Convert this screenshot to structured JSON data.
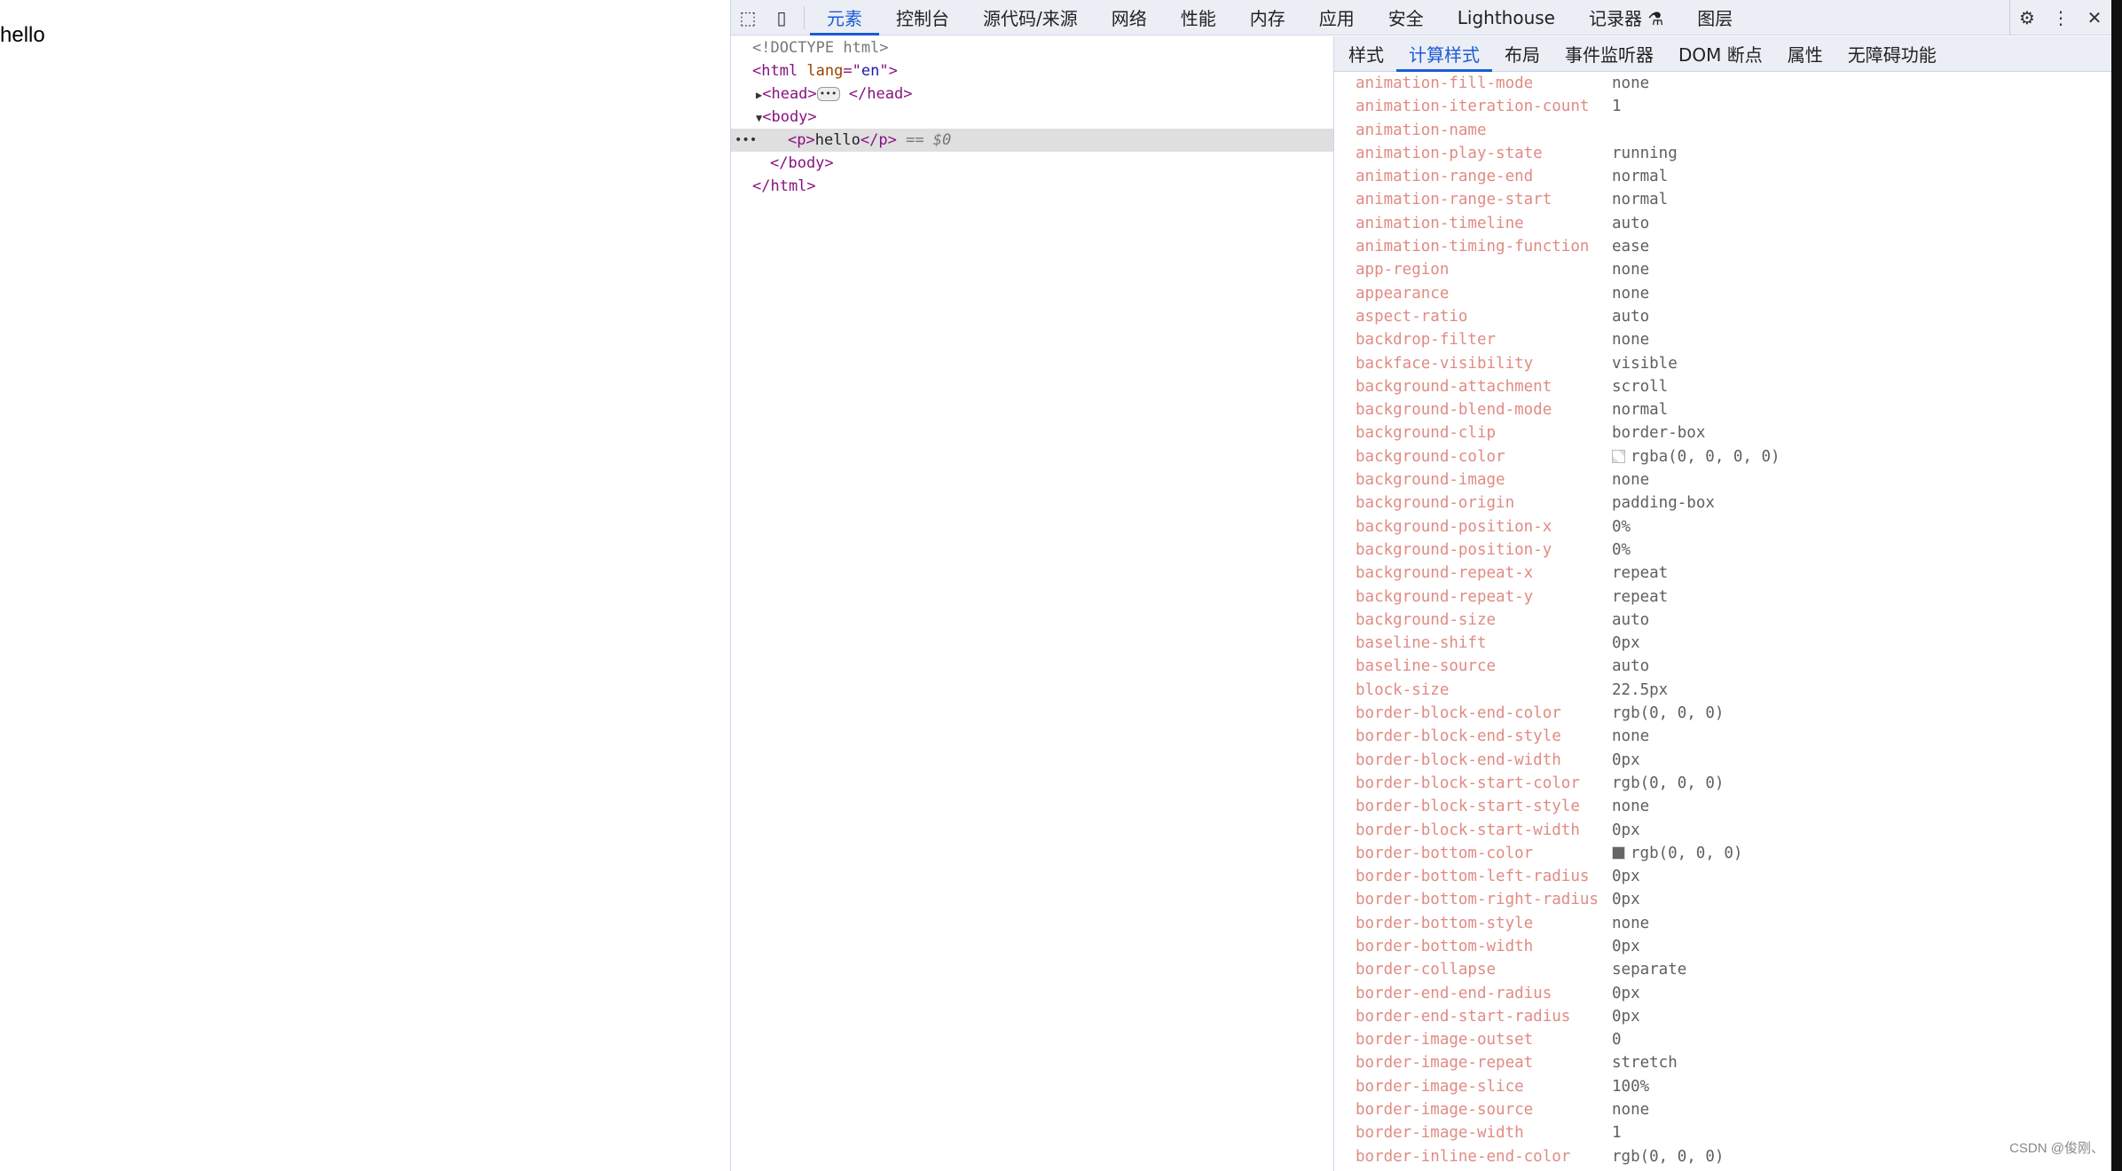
{
  "page": {
    "text": "hello"
  },
  "toolbar": {
    "tabs": [
      "元素",
      "控制台",
      "源代码/来源",
      "网络",
      "性能",
      "内存",
      "应用",
      "安全",
      "Lighthouse",
      "记录器 ⚗",
      "图层"
    ],
    "active_tab": "元素"
  },
  "dom": {
    "doctype": "<!DOCTYPE html>",
    "html_open": "<html",
    "lang_attr": " lang",
    "lang_eq": "=\"",
    "lang_val": "en",
    "lang_close": "\">",
    "head_open": "<head>",
    "head_close": "</head>",
    "body_open": "<body>",
    "p_open": "<p>",
    "p_text": "hello",
    "p_close": "</p>",
    "selected_marker": " == $0",
    "body_close": "</body>",
    "html_close": "</html>"
  },
  "sidebar": {
    "tabs": [
      "样式",
      "计算样式",
      "布局",
      "事件监听器",
      "DOM 断点",
      "属性",
      "无障碍功能"
    ],
    "active_tab": "计算样式",
    "properties": [
      {
        "name": "animation-fill-mode",
        "value": "none"
      },
      {
        "name": "animation-iteration-count",
        "value": "1"
      },
      {
        "name": "animation-name",
        "value": ""
      },
      {
        "name": "animation-play-state",
        "value": "running"
      },
      {
        "name": "animation-range-end",
        "value": "normal"
      },
      {
        "name": "animation-range-start",
        "value": "normal"
      },
      {
        "name": "animation-timeline",
        "value": "auto"
      },
      {
        "name": "animation-timing-function",
        "value": "ease"
      },
      {
        "name": "app-region",
        "value": "none"
      },
      {
        "name": "appearance",
        "value": "none"
      },
      {
        "name": "aspect-ratio",
        "value": "auto"
      },
      {
        "name": "backdrop-filter",
        "value": "none"
      },
      {
        "name": "backface-visibility",
        "value": "visible"
      },
      {
        "name": "background-attachment",
        "value": "scroll"
      },
      {
        "name": "background-blend-mode",
        "value": "normal"
      },
      {
        "name": "background-clip",
        "value": "border-box"
      },
      {
        "name": "background-color",
        "value": "rgba(0, 0, 0, 0)",
        "swatch": "transparent"
      },
      {
        "name": "background-image",
        "value": "none"
      },
      {
        "name": "background-origin",
        "value": "padding-box"
      },
      {
        "name": "background-position-x",
        "value": "0%"
      },
      {
        "name": "background-position-y",
        "value": "0%"
      },
      {
        "name": "background-repeat-x",
        "value": "repeat"
      },
      {
        "name": "background-repeat-y",
        "value": "repeat"
      },
      {
        "name": "background-size",
        "value": "auto"
      },
      {
        "name": "baseline-shift",
        "value": "0px"
      },
      {
        "name": "baseline-source",
        "value": "auto"
      },
      {
        "name": "block-size",
        "value": "22.5px"
      },
      {
        "name": "border-block-end-color",
        "value": "rgb(0, 0, 0)"
      },
      {
        "name": "border-block-end-style",
        "value": "none"
      },
      {
        "name": "border-block-end-width",
        "value": "0px"
      },
      {
        "name": "border-block-start-color",
        "value": "rgb(0, 0, 0)"
      },
      {
        "name": "border-block-start-style",
        "value": "none"
      },
      {
        "name": "border-block-start-width",
        "value": "0px"
      },
      {
        "name": "border-bottom-color",
        "value": "rgb(0, 0, 0)",
        "swatch": "#000000"
      },
      {
        "name": "border-bottom-left-radius",
        "value": "0px"
      },
      {
        "name": "border-bottom-right-radius",
        "value": "0px"
      },
      {
        "name": "border-bottom-style",
        "value": "none"
      },
      {
        "name": "border-bottom-width",
        "value": "0px"
      },
      {
        "name": "border-collapse",
        "value": "separate"
      },
      {
        "name": "border-end-end-radius",
        "value": "0px"
      },
      {
        "name": "border-end-start-radius",
        "value": "0px"
      },
      {
        "name": "border-image-outset",
        "value": "0"
      },
      {
        "name": "border-image-repeat",
        "value": "stretch"
      },
      {
        "name": "border-image-slice",
        "value": "100%"
      },
      {
        "name": "border-image-source",
        "value": "none"
      },
      {
        "name": "border-image-width",
        "value": "1"
      },
      {
        "name": "border-inline-end-color",
        "value": "rgb(0, 0, 0)"
      }
    ]
  },
  "watermark": "CSDN @俊刚、",
  "colors": {
    "accent": "#1a5bd6",
    "prop_name": "#e08b83",
    "tag": "#881280"
  }
}
